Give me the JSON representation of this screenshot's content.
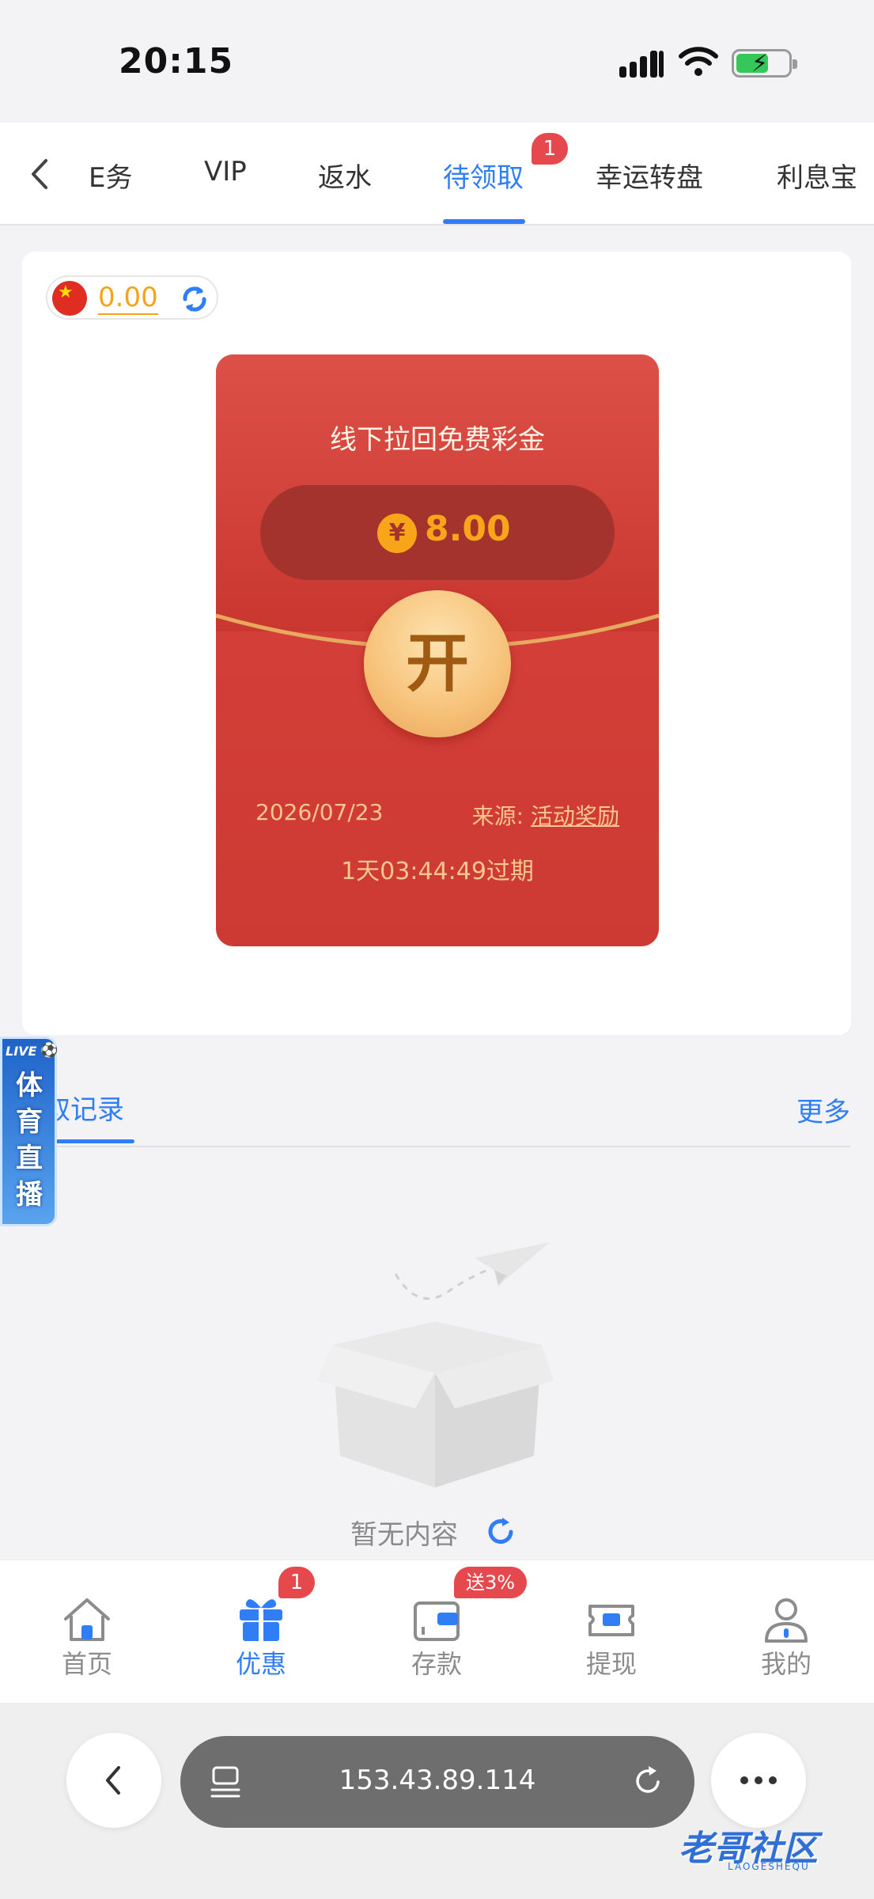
{
  "status_bar": {
    "time": "20:15"
  },
  "tabs": [
    {
      "label": "E务",
      "active": false
    },
    {
      "label": "VIP",
      "active": false
    },
    {
      "label": "返水",
      "active": false
    },
    {
      "label": "待领取",
      "active": true,
      "badge": "1"
    },
    {
      "label": "幸运转盘",
      "active": false
    },
    {
      "label": "利息宝",
      "active": false
    }
  ],
  "balance": {
    "amount": "0.00"
  },
  "envelope": {
    "title": "线下拉回免费彩金",
    "currency_symbol": "¥",
    "amount": "8.00",
    "open_label": "开",
    "date": "2026/07/23",
    "source_label": "来源:",
    "source_value": "活动奖励",
    "expire_text": "1天03:44:49过期"
  },
  "records": {
    "tab_label": "取记录",
    "more_label": "更多"
  },
  "live_badge": {
    "tag": "LIVE",
    "text": "体育直播"
  },
  "empty_state": {
    "text": "暂无内容"
  },
  "bottom_nav": [
    {
      "label": "首页",
      "active": false
    },
    {
      "label": "优惠",
      "active": true,
      "badge": "1"
    },
    {
      "label": "存款",
      "active": false,
      "badge": "送3%"
    },
    {
      "label": "提现",
      "active": false
    },
    {
      "label": "我的",
      "active": false
    }
  ],
  "browser": {
    "url": "153.43.89.114"
  },
  "watermark": {
    "text": "老哥社区",
    "sub": "LAOGESHEQU"
  },
  "colors": {
    "accent": "#2f7ef6",
    "badge": "#e5484d",
    "envelope": "#cd3a33",
    "gold": "#f9a51a"
  }
}
